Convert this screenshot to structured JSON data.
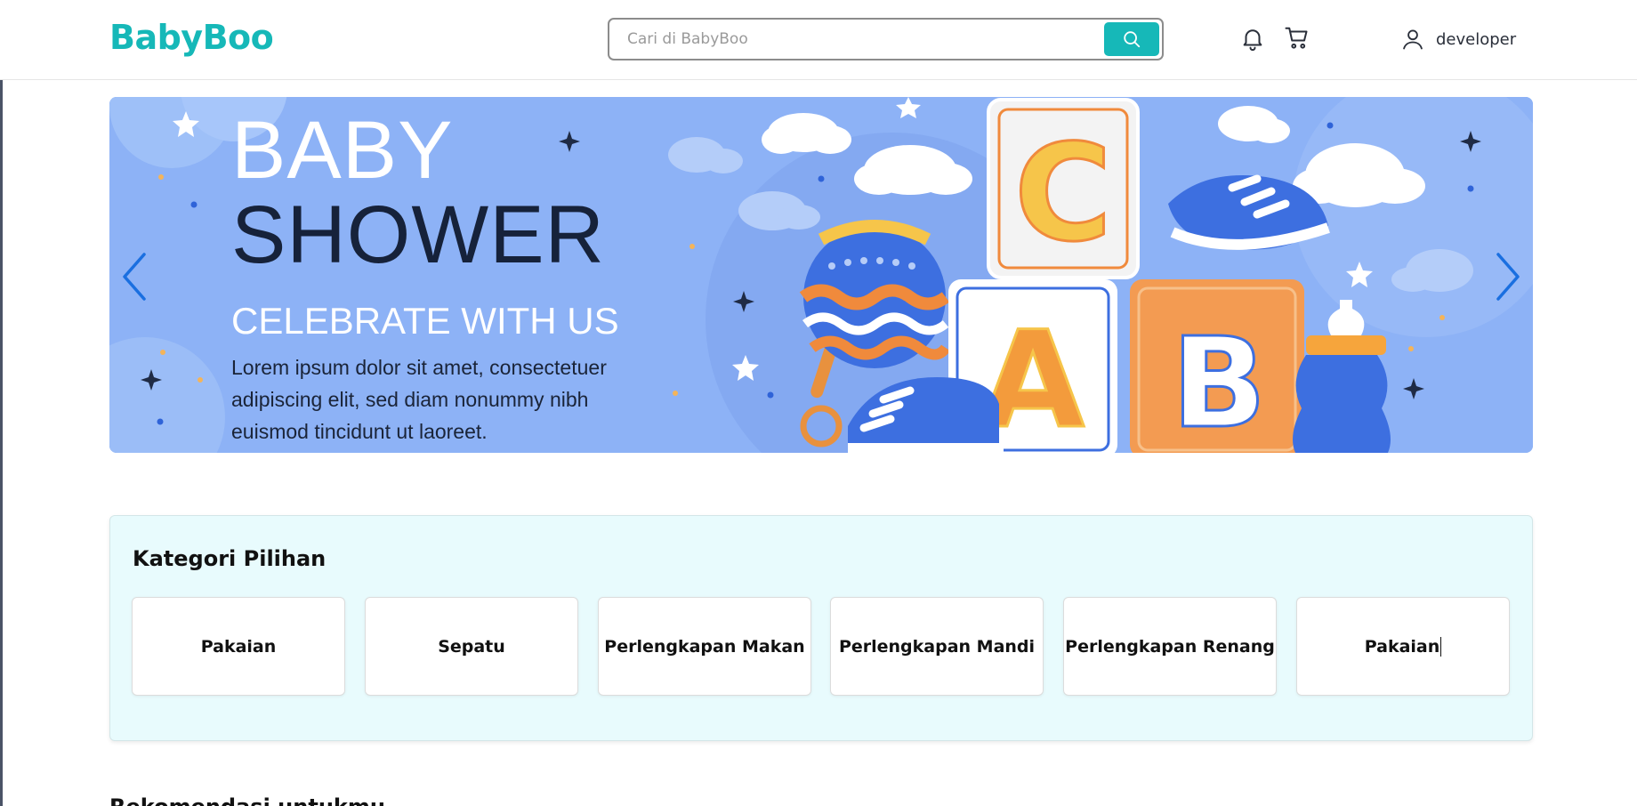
{
  "header": {
    "logo": "BabyBoo",
    "search_placeholder": "Cari di BabyBoo",
    "username": "developer"
  },
  "banner": {
    "title_line1": "BABY",
    "title_line2": "SHOWER",
    "subtitle": "CELEBRATE WITH US",
    "body": "Lorem ipsum dolor sit amet, consectetuer adipiscing elit, sed diam nonummy nibh euismod tincidunt ut laoreet.",
    "block_letters": [
      "C",
      "A",
      "B"
    ]
  },
  "categories": {
    "title": "Kategori Pilihan",
    "items": [
      {
        "label": "Pakaian"
      },
      {
        "label": "Sepatu"
      },
      {
        "label": "Perlengkapan Makan"
      },
      {
        "label": "Perlengkapan Mandi"
      },
      {
        "label": "Perlengkapan Renang"
      },
      {
        "label": "Pakaian"
      }
    ]
  },
  "recommendation": {
    "title": "Rekomendasi untukmu"
  },
  "colors": {
    "brand": "#16b8b8",
    "banner_bg": "#8fb3f5",
    "category_bg": "#e8fbfd",
    "arrow": "#1a6fe0"
  },
  "icons": {
    "search": "search-icon",
    "notification": "bell-icon",
    "cart": "cart-icon",
    "user": "user-icon",
    "prev": "chevron-left-icon",
    "next": "chevron-right-icon"
  }
}
